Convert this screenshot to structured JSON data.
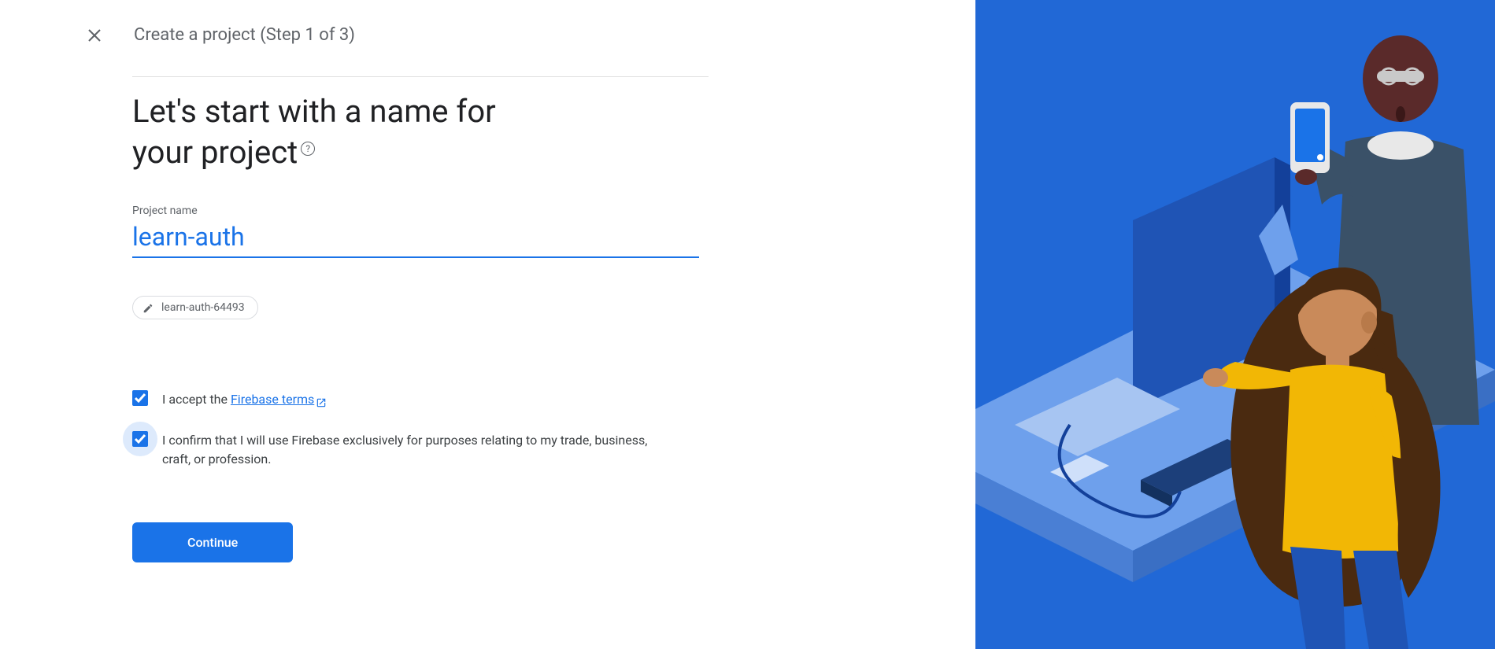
{
  "header": {
    "title": "Create a project (Step 1 of 3)"
  },
  "main": {
    "heading_line1": "Let's start with a name for",
    "heading_line2": "your project",
    "help_glyph": "?",
    "field_label": "Project name",
    "field_value": "learn-auth",
    "chip_text": "learn-auth-64493"
  },
  "terms": {
    "accept_prefix": "I accept the ",
    "accept_link": "Firebase terms",
    "confirm_text": "I confirm that I will use Firebase exclusively for purposes relating to my trade, business, craft, or profession."
  },
  "actions": {
    "continue": "Continue"
  }
}
